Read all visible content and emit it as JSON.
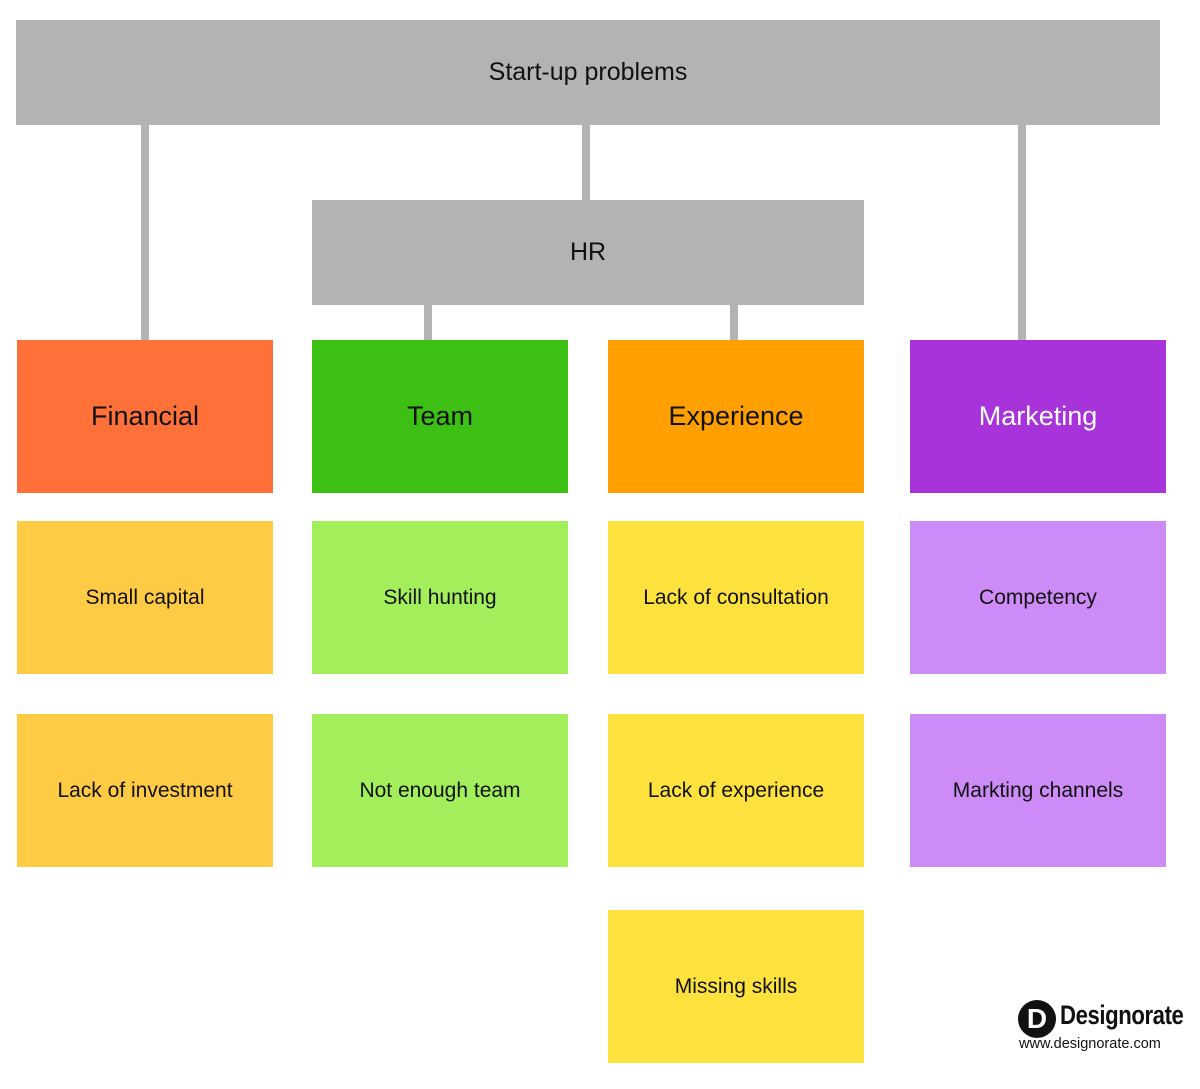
{
  "root": {
    "label": "Start-up problems",
    "color": "#b3b3b3"
  },
  "hr": {
    "label": "HR",
    "color": "#b3b3b3"
  },
  "categories": [
    {
      "label": "Financial",
      "color": "#ff7139",
      "text_color": "#111111",
      "items": [
        {
          "label": "Small capital"
        },
        {
          "label": "Lack of investment"
        }
      ],
      "item_color": "#ffca44"
    },
    {
      "label": "Team",
      "color": "#3cc013",
      "text_color": "#111111",
      "items": [
        {
          "label": "Skill hunting"
        },
        {
          "label": "Not enough team"
        }
      ],
      "item_color": "#a3ef5b"
    },
    {
      "label": "Experience",
      "color": "#ffa000",
      "text_color": "#111111",
      "items": [
        {
          "label": "Lack of consultation"
        },
        {
          "label": "Lack of experience"
        },
        {
          "label": "Missing skills"
        }
      ],
      "item_color": "#fde23d"
    },
    {
      "label": "Marketing",
      "color": "#a833da",
      "text_color": "#ffffff",
      "items": [
        {
          "label": "Competency"
        },
        {
          "label": "Markting channels"
        }
      ],
      "item_color": "#cc8bf7"
    }
  ],
  "logo": {
    "mark": "D",
    "name": "Designorate",
    "url": "www.designorate.com"
  }
}
